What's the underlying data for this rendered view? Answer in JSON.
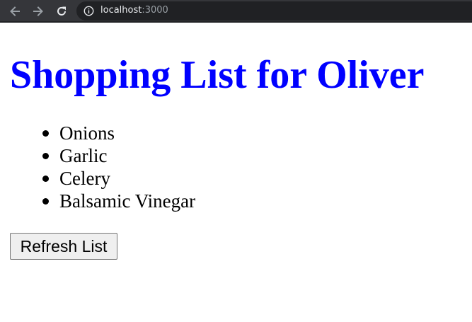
{
  "browser": {
    "url_host": "localhost",
    "url_port": ":3000",
    "icons": {
      "back": "arrow-left-icon",
      "forward": "arrow-right-icon",
      "reload": "reload-icon",
      "site_info": "info-icon"
    }
  },
  "page": {
    "title": "Shopping List for Oliver",
    "title_color": "#0000ff",
    "items": [
      {
        "label": "Onions"
      },
      {
        "label": "Garlic"
      },
      {
        "label": "Celery"
      },
      {
        "label": "Balsamic Vinegar"
      }
    ],
    "refresh_label": "Refresh List"
  }
}
